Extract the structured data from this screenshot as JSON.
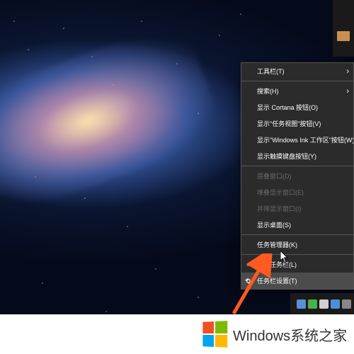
{
  "context_menu": {
    "items": [
      {
        "label": "工具栏(T)",
        "submenu": true
      },
      {
        "sep": true
      },
      {
        "label": "搜索(H)",
        "submenu": true
      },
      {
        "label": "显示 Cortana 按钮(O)"
      },
      {
        "label": "显示\"任务视图\"按钮(V)"
      },
      {
        "label": "显示\"Windows Ink 工作区\"按钮(W)"
      },
      {
        "label": "显示触摸键盘按钮(Y)"
      },
      {
        "sep": true
      },
      {
        "label": "层叠窗口(D)",
        "disabled": true
      },
      {
        "label": "堆叠显示窗口(E)",
        "disabled": true
      },
      {
        "label": "并排显示窗口(I)",
        "disabled": true
      },
      {
        "label": "显示桌面(S)"
      },
      {
        "sep": true
      },
      {
        "label": "任务管理器(K)"
      },
      {
        "sep": true
      },
      {
        "label": "锁定任务栏(L)",
        "checked": true
      },
      {
        "label": "任务栏设置(T)",
        "highlighted": true,
        "gear": true
      }
    ]
  },
  "watermark": {
    "text": "Windows系统之家"
  },
  "tray_icons": [
    "app1",
    "app2",
    "app3",
    "app4",
    "app5"
  ]
}
